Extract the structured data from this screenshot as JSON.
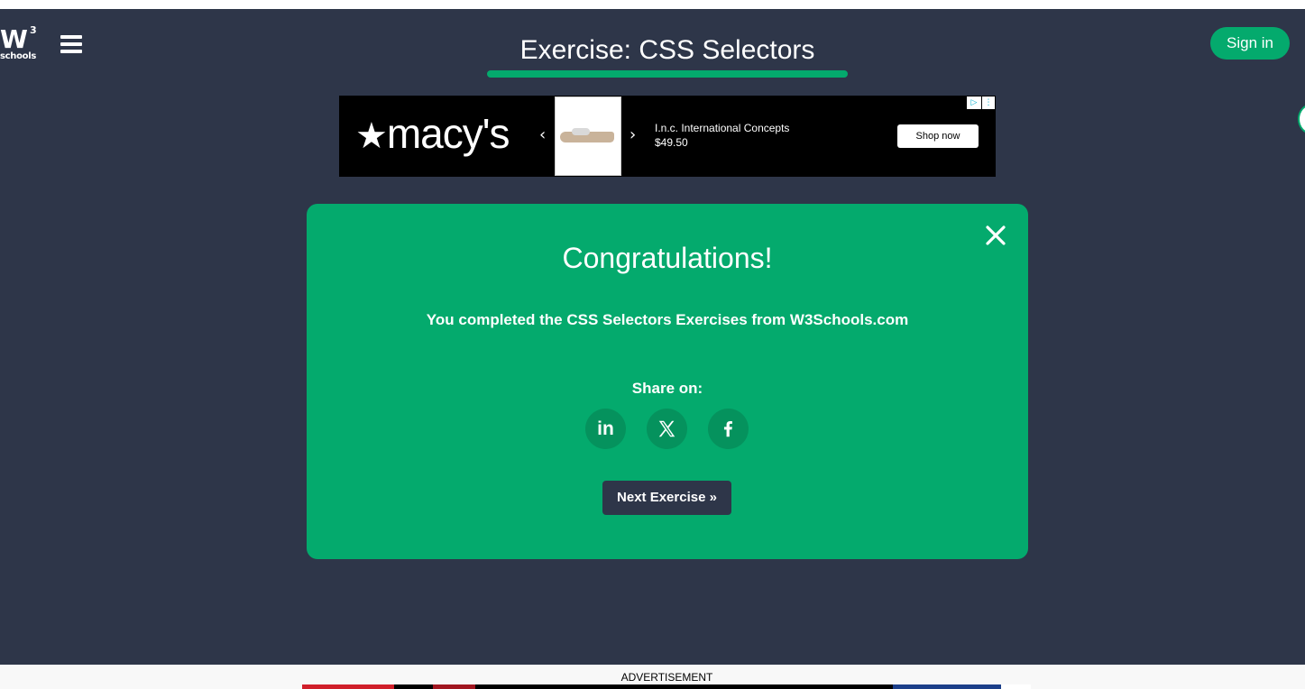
{
  "header": {
    "logo_main": "W",
    "logo_sup": "3",
    "logo_sub": "schools",
    "title": "Exercise: CSS Selectors",
    "signin_label": "Sign in"
  },
  "top_ad": {
    "brand": "macy's",
    "prev_glyph": "‹",
    "next_glyph": "›",
    "product_name": "I.n.c. International Concepts",
    "product_price": "$49.50",
    "cta": "Shop now"
  },
  "modal": {
    "heading": "Congratulations!",
    "message": "You completed the CSS Selectors Exercises from W3Schools.com",
    "share_label": "Share on:",
    "share_buttons": [
      {
        "name": "linkedin",
        "glyph": "in"
      },
      {
        "name": "x",
        "glyph": "X"
      },
      {
        "name": "facebook",
        "glyph": "f"
      }
    ],
    "next_label": "Next Exercise »"
  },
  "footer": {
    "ad_label": "ADVERTISEMENT"
  },
  "colors": {
    "background": "#2e3649",
    "accent": "#04aa6d",
    "accent_dark": "#05925d"
  },
  "icons": [
    "hamburger-menu-icon",
    "close-icon",
    "linkedin-icon",
    "x-icon",
    "facebook-icon",
    "adchoices-icon"
  ]
}
